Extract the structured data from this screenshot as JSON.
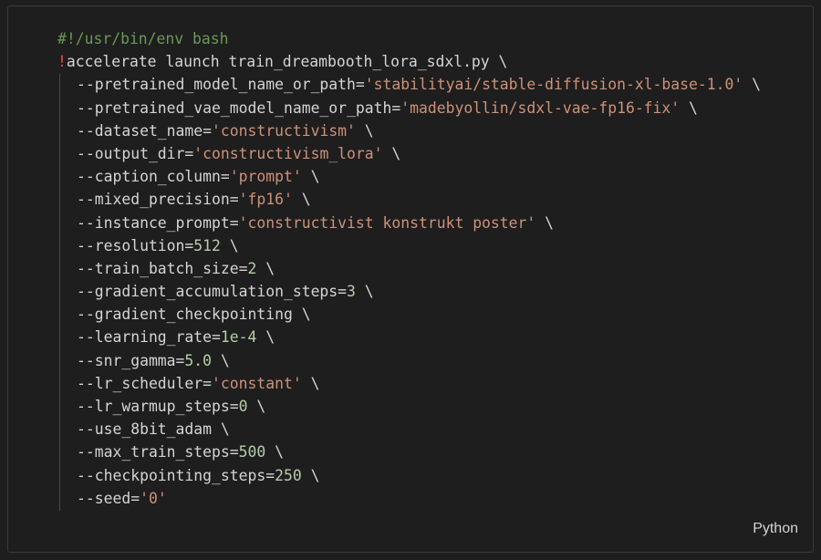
{
  "code_block": {
    "language_label": "Python",
    "lines": [
      {
        "tokens": [
          {
            "text": "#!/usr/bin/env bash",
            "kind": "comment"
          }
        ]
      },
      {
        "tokens": [
          {
            "text": "!",
            "kind": "bang"
          },
          {
            "text": "accelerate launch train_dreambooth_lora_sdxl.py \\",
            "kind": "plain"
          }
        ]
      },
      {
        "tokens": [
          {
            "text": "--pretrained_model_name_or_path=",
            "kind": "plain"
          },
          {
            "text": "'stabilityai/stable-diffusion-xl-base-1.0'",
            "kind": "arg"
          },
          {
            "text": " \\",
            "kind": "plain"
          }
        ]
      },
      {
        "tokens": [
          {
            "text": "--pretrained_vae_model_name_or_path=",
            "kind": "plain"
          },
          {
            "text": "'madebyollin/sdxl-vae-fp16-fix'",
            "kind": "arg"
          },
          {
            "text": " \\",
            "kind": "plain"
          }
        ]
      },
      {
        "tokens": [
          {
            "text": "--dataset_name=",
            "kind": "plain"
          },
          {
            "text": "'constructivism'",
            "kind": "arg"
          },
          {
            "text": " \\",
            "kind": "plain"
          }
        ]
      },
      {
        "tokens": [
          {
            "text": "--output_dir=",
            "kind": "plain"
          },
          {
            "text": "'constructivism_lora'",
            "kind": "arg"
          },
          {
            "text": " \\",
            "kind": "plain"
          }
        ]
      },
      {
        "tokens": [
          {
            "text": "--caption_column=",
            "kind": "plain"
          },
          {
            "text": "'prompt'",
            "kind": "arg"
          },
          {
            "text": " \\",
            "kind": "plain"
          }
        ]
      },
      {
        "tokens": [
          {
            "text": "--mixed_precision=",
            "kind": "plain"
          },
          {
            "text": "'fp16'",
            "kind": "arg"
          },
          {
            "text": " \\",
            "kind": "plain"
          }
        ]
      },
      {
        "tokens": [
          {
            "text": "--instance_prompt=",
            "kind": "plain"
          },
          {
            "text": "'constructivist konstrukt poster'",
            "kind": "arg"
          },
          {
            "text": " \\",
            "kind": "plain"
          }
        ]
      },
      {
        "tokens": [
          {
            "text": "--resolution=",
            "kind": "plain"
          },
          {
            "text": "512",
            "kind": "num"
          },
          {
            "text": " \\",
            "kind": "plain"
          }
        ]
      },
      {
        "tokens": [
          {
            "text": "--train_batch_size=",
            "kind": "plain"
          },
          {
            "text": "2",
            "kind": "num"
          },
          {
            "text": " \\",
            "kind": "plain"
          }
        ]
      },
      {
        "tokens": [
          {
            "text": "--gradient_accumulation_steps=",
            "kind": "plain"
          },
          {
            "text": "3",
            "kind": "num"
          },
          {
            "text": " \\",
            "kind": "plain"
          }
        ]
      },
      {
        "tokens": [
          {
            "text": "--gradient_checkpointing \\",
            "kind": "plain"
          }
        ]
      },
      {
        "tokens": [
          {
            "text": "--learning_rate=",
            "kind": "plain"
          },
          {
            "text": "1e-4",
            "kind": "num"
          },
          {
            "text": " \\",
            "kind": "plain"
          }
        ]
      },
      {
        "tokens": [
          {
            "text": "--snr_gamma=",
            "kind": "plain"
          },
          {
            "text": "5.0",
            "kind": "num"
          },
          {
            "text": " \\",
            "kind": "plain"
          }
        ]
      },
      {
        "tokens": [
          {
            "text": "--lr_scheduler=",
            "kind": "plain"
          },
          {
            "text": "'constant'",
            "kind": "arg"
          },
          {
            "text": " \\",
            "kind": "plain"
          }
        ]
      },
      {
        "tokens": [
          {
            "text": "--lr_warmup_steps=",
            "kind": "plain"
          },
          {
            "text": "0",
            "kind": "num"
          },
          {
            "text": " \\",
            "kind": "plain"
          }
        ]
      },
      {
        "tokens": [
          {
            "text": "--use_8bit_adam \\",
            "kind": "plain"
          }
        ]
      },
      {
        "tokens": [
          {
            "text": "--max_train_steps=",
            "kind": "plain"
          },
          {
            "text": "500",
            "kind": "num"
          },
          {
            "text": " \\",
            "kind": "plain"
          }
        ]
      },
      {
        "tokens": [
          {
            "text": "--checkpointing_steps=",
            "kind": "plain"
          },
          {
            "text": "250",
            "kind": "num"
          },
          {
            "text": " \\",
            "kind": "plain"
          }
        ]
      },
      {
        "tokens": [
          {
            "text": "--seed=",
            "kind": "plain"
          },
          {
            "text": "'0'",
            "kind": "arg"
          }
        ]
      }
    ]
  },
  "colors": {
    "background": "#1e1e1e",
    "comment": "#6a9955",
    "bang": "#f44747",
    "string": "#ce9178",
    "number": "#b5cea8",
    "text": "#d4d4d4"
  }
}
